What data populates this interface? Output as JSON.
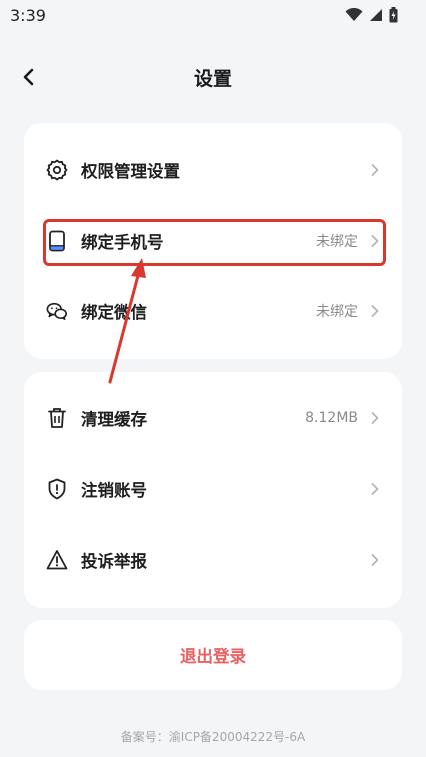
{
  "status_bar": {
    "time": "3:39"
  },
  "header": {
    "title": "设置",
    "back_icon": "chevron-left-icon"
  },
  "group1": [
    {
      "label": "权限管理设置",
      "value": "",
      "icon": "gear-icon"
    },
    {
      "label": "绑定手机号",
      "value": "未绑定",
      "icon": "phone-icon"
    },
    {
      "label": "绑定微信",
      "value": "未绑定",
      "icon": "wechat-icon"
    }
  ],
  "group2": [
    {
      "label": "清理缓存",
      "value": "8.12MB",
      "icon": "trash-icon"
    },
    {
      "label": "注销账号",
      "value": "",
      "icon": "shield-icon"
    },
    {
      "label": "投诉举报",
      "value": "",
      "icon": "warning-icon"
    }
  ],
  "logout": {
    "label": "退出登录"
  },
  "footer": {
    "text": "备案号：渝ICP备20004222号-6A"
  },
  "colors": {
    "accent_red": "#d8382d",
    "logout_text": "#ea5f5f",
    "background": "#f4f5f7"
  }
}
